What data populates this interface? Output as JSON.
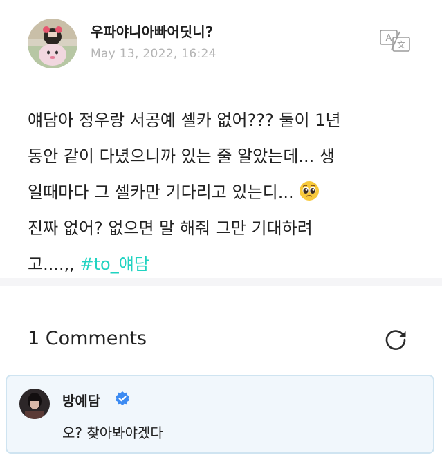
{
  "post": {
    "author": "우파야니아빠어딧니?",
    "date": "May 13, 2022, 16:24",
    "lines": [
      "얘담아 정우랑 서공예 셀카 없어??? 둘이 1년",
      "동안 같이 다녔으니까 있는 줄 알았는데... 생",
      "일때마다 그 셀카만 기다리고 있는디...",
      "진짜 없어? 없으면 말 해줘 그만 기대하려",
      "고....,,"
    ],
    "hashtag": "#to_얘담",
    "emoji": "pleading-face-emoji"
  },
  "comments": {
    "count_label": "1 Comments",
    "items": [
      {
        "name": "방예담",
        "text": "오? 찾아봐야겠다",
        "verified": true
      }
    ]
  },
  "icons": {
    "translate": "translate-icon",
    "refresh": "refresh-icon",
    "verified": "verified-badge-icon"
  },
  "colors": {
    "hashtag": "#20d3c1",
    "date": "#b4b4b4",
    "divider": "#f5f5f7",
    "comment_bg": "#f1f7fc",
    "comment_border": "#cfe4f1",
    "verified": "#3d8bf2"
  }
}
